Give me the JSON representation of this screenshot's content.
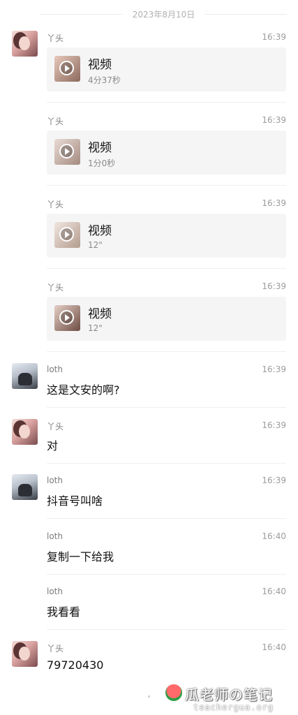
{
  "date_separator": "2023年8月10日",
  "messages": [
    {
      "sender": "丫头",
      "time": "16:39",
      "type": "video",
      "title": "视频",
      "duration": "4分37秒"
    },
    {
      "sender": "丫头",
      "time": "16:39",
      "type": "video",
      "title": "视频",
      "duration": "1分0秒"
    },
    {
      "sender": "丫头",
      "time": "16:39",
      "type": "video",
      "title": "视频",
      "duration": "12\""
    },
    {
      "sender": "丫头",
      "time": "16:39",
      "type": "video",
      "title": "视频",
      "duration": "12\""
    },
    {
      "sender": "loth",
      "time": "16:39",
      "type": "text",
      "text": "这是文安的啊?"
    },
    {
      "sender": "丫头",
      "time": "16:39",
      "type": "text",
      "text": "对"
    },
    {
      "sender": "loth",
      "time": "16:39",
      "type": "text",
      "text": "抖音号叫啥"
    },
    {
      "sender": "loth",
      "time": "16:40",
      "type": "text",
      "text": "复制一下给我"
    },
    {
      "sender": "loth",
      "time": "16:40",
      "type": "text",
      "text": "我看看"
    },
    {
      "sender": "丫头",
      "time": "16:40",
      "type": "text",
      "text": "79720430"
    }
  ],
  "watermark": {
    "main": "瓜老师の笔记",
    "sub": "teachergua.org"
  },
  "icons": {
    "play": "play-icon",
    "watermark": "watermelon-icon"
  }
}
